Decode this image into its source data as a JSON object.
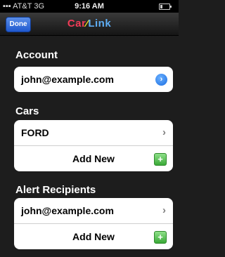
{
  "status_bar": {
    "carrier": "AT&T",
    "network": "3G",
    "time": "9:16 AM"
  },
  "nav": {
    "done_label": "Done",
    "logo_part1": "Car",
    "logo_part2": "Link"
  },
  "sections": {
    "account": {
      "title": "Account",
      "email": "john@example.com"
    },
    "cars": {
      "title": "Cars",
      "items": [
        {
          "label": "FORD"
        }
      ],
      "add_label": "Add New"
    },
    "alerts": {
      "title": "Alert Recipients",
      "items": [
        {
          "label": "john@example.com"
        }
      ],
      "add_label": "Add New"
    }
  },
  "icons": {
    "disclosure": "blue-disclosure-icon",
    "chevron": "chevron-right-icon",
    "add": "green-plus-icon"
  },
  "colors": {
    "background": "#1d1d1d",
    "done_button": "#2f6fe0",
    "logo_car": "#f13b57",
    "logo_slash": "#f7e11a",
    "logo_link": "#5eaef5"
  }
}
